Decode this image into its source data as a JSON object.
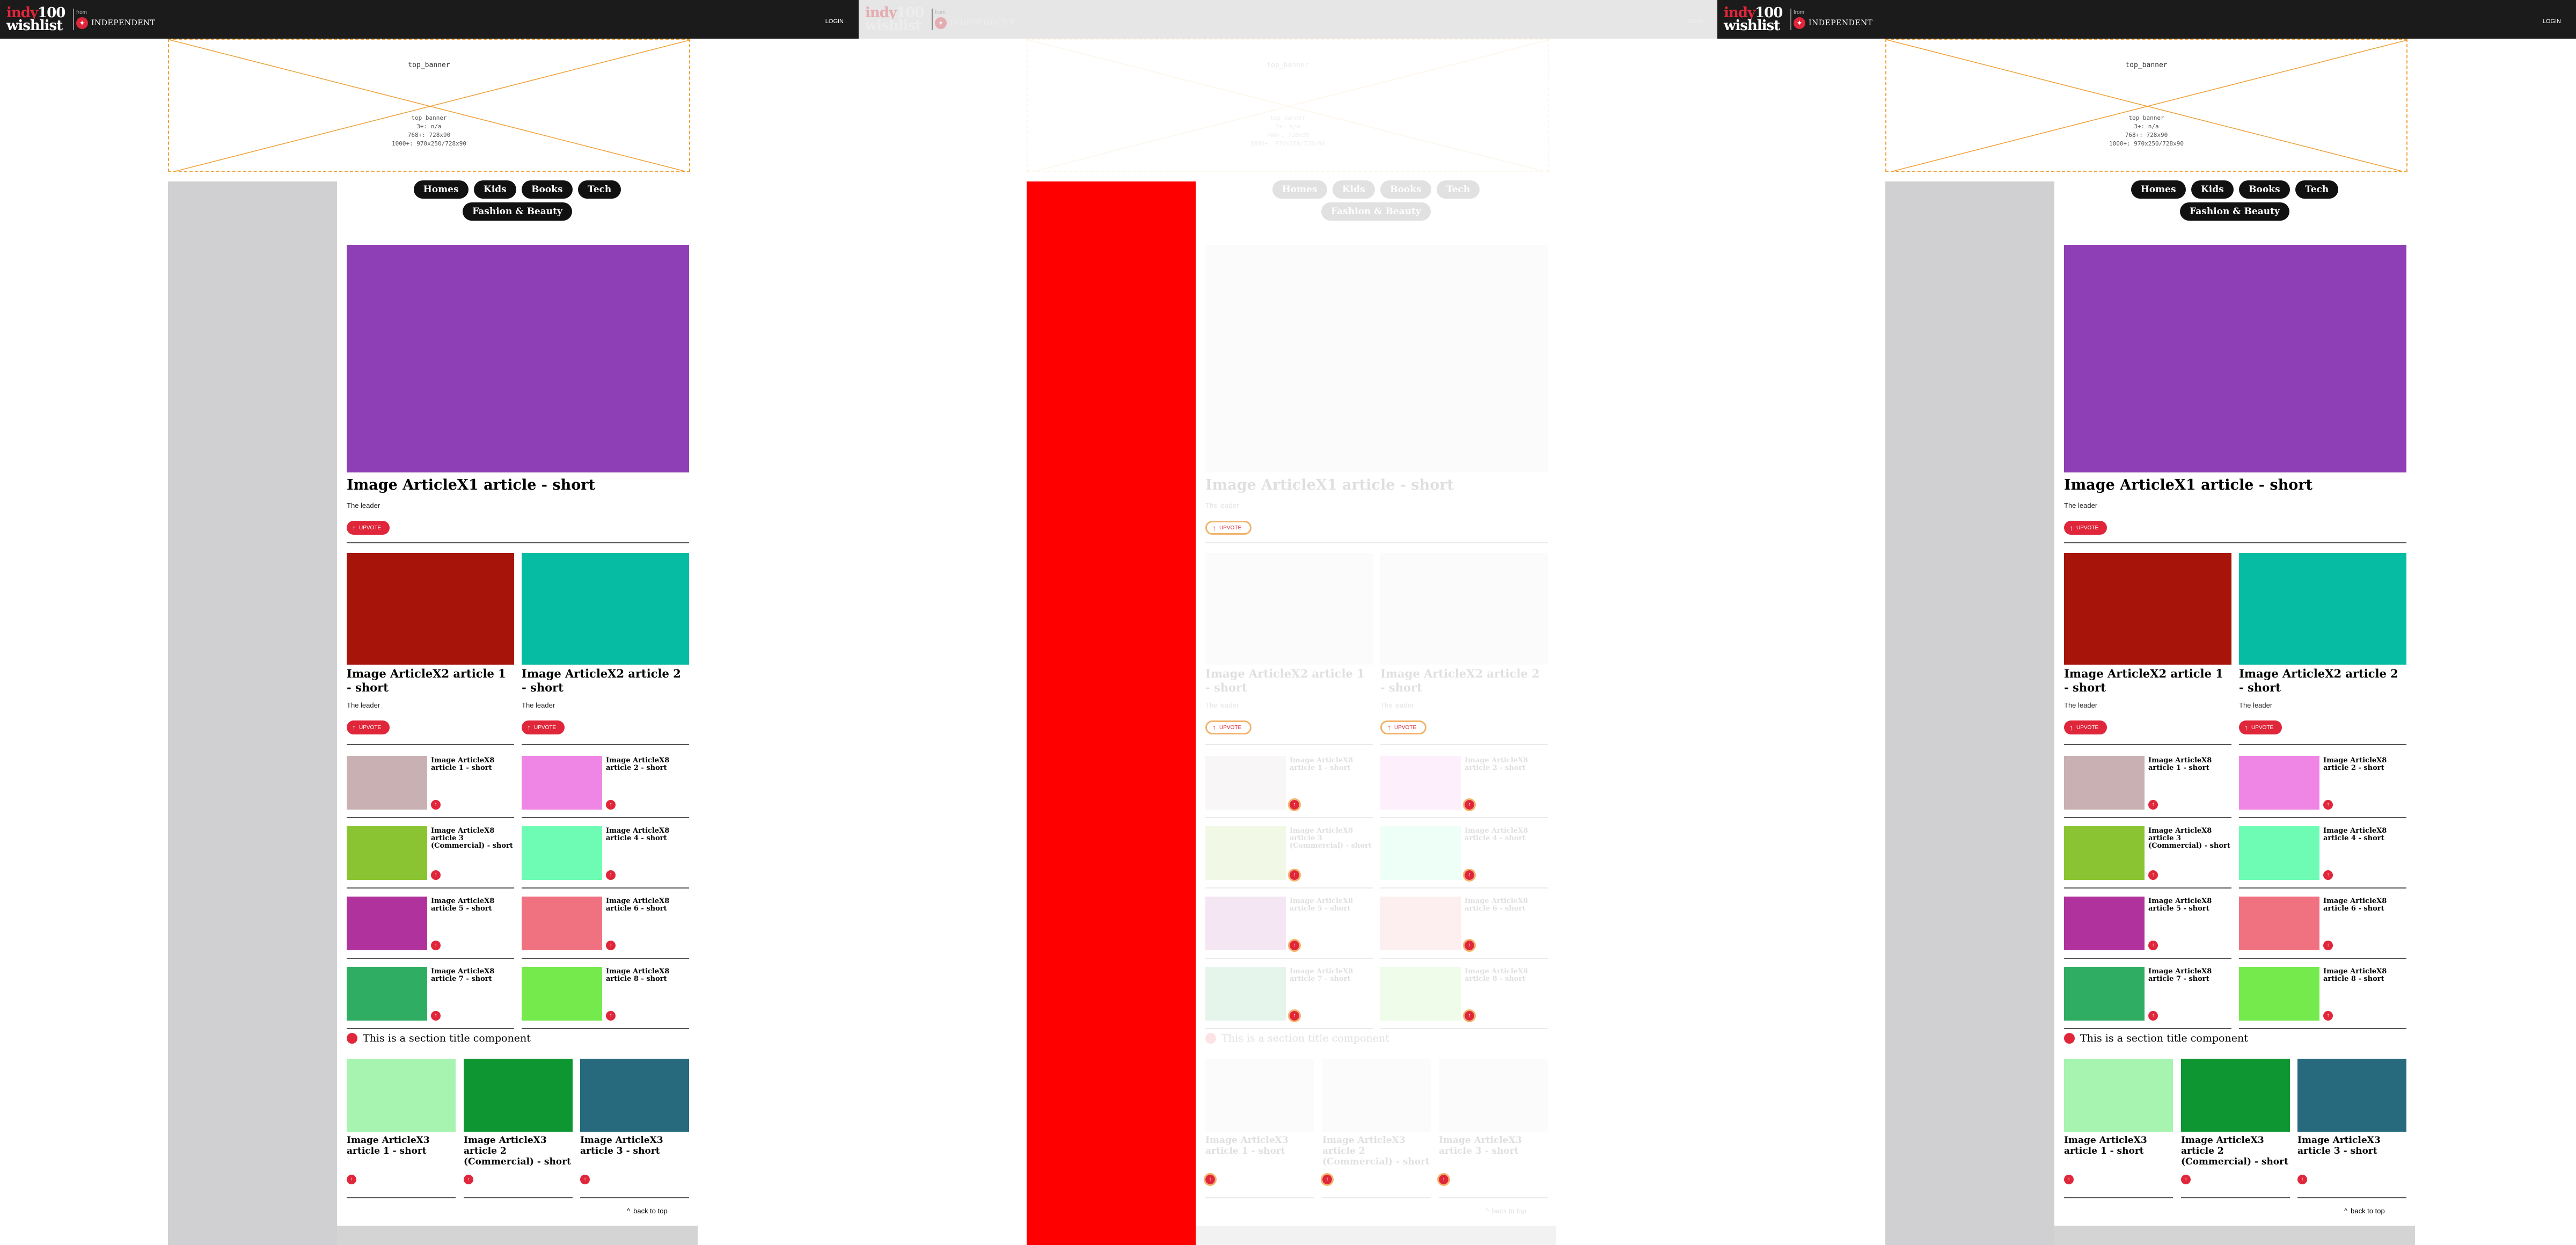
{
  "header": {
    "logo_line1_a": "indy",
    "logo_line1_b": "100",
    "logo_line2": "wishlist",
    "from_label": "from",
    "publisher": "INDEPENDENT",
    "login_label": "LOGIN"
  },
  "banner": {
    "label": "top_banner",
    "details": [
      "top_banner",
      "3+: n/a",
      "768+: 728x90",
      "1000+: 970x250/728x90"
    ]
  },
  "nav": {
    "row1": [
      "Homes",
      "Kids",
      "Books",
      "Tech"
    ],
    "row2": [
      "Fashion & Beauty"
    ]
  },
  "hero": {
    "title": "Image ArticleX1 article - short",
    "leader": "The leader",
    "upvote": "UPVOTE",
    "color": "#8e3fb6"
  },
  "x2": [
    {
      "title": "Image ArticleX2 article 1 - short",
      "leader": "The leader",
      "upvote": "UPVOTE",
      "color": "#a7140a"
    },
    {
      "title": "Image ArticleX2 article 2 - short",
      "leader": "The leader",
      "upvote": "UPVOTE",
      "color": "#06bca3"
    }
  ],
  "x8": [
    {
      "title": "Image ArticleX8 article 1 - short",
      "color": "#c9b1b3"
    },
    {
      "title": "Image ArticleX8 article 2 - short",
      "color": "#ef86e6"
    },
    {
      "title": "Image ArticleX8 article 3 (Commercial) - short",
      "color": "#8bc432"
    },
    {
      "title": "Image ArticleX8 article 4 - short",
      "color": "#6efcb4"
    },
    {
      "title": "Image ArticleX8 article 5 - short",
      "color": "#b0339d"
    },
    {
      "title": "Image ArticleX8 article 6 - short",
      "color": "#f07280"
    },
    {
      "title": "Image ArticleX8 article 7 - short",
      "color": "#2fae63"
    },
    {
      "title": "Image ArticleX8 article 8 - short",
      "color": "#74ea4c"
    }
  ],
  "section_title": "This is a section title component",
  "x3": [
    {
      "title": "Image ArticleX3 article 1 - short",
      "color": "#a6f4b0"
    },
    {
      "title": "Image ArticleX3 article 2 (Commercial) - short",
      "color": "#0e9633"
    },
    {
      "title": "Image ArticleX3 article 3 - short",
      "color": "#276a7e"
    }
  ],
  "back_to_top": "back to top",
  "colors": {
    "accent": "#e0263a",
    "header_bg": "#1b1b1b",
    "banner_border": "#f0a23a",
    "rail": "#d0d0d3",
    "highlight_rail": "#ff0000"
  }
}
